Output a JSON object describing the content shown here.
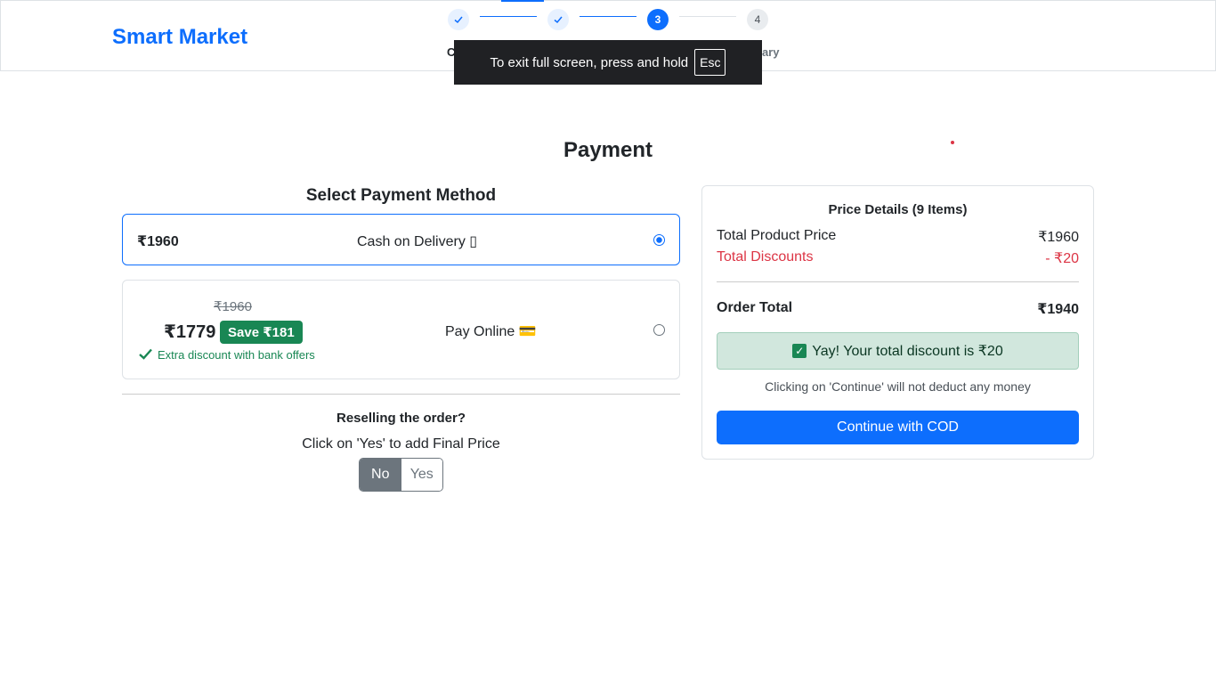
{
  "brand": "Smart Market",
  "steps": [
    {
      "label": "C",
      "state": "done"
    },
    {
      "label": "",
      "state": "done"
    },
    {
      "number": "3",
      "state": "active"
    },
    {
      "number": "4",
      "label": "nary",
      "state": "todo"
    }
  ],
  "fullscreen_toast": {
    "text": "To exit full screen, press and hold",
    "key": "Esc"
  },
  "page_title": "Payment",
  "payment_section": {
    "title": "Select Payment Method",
    "cod": {
      "price": "₹1960",
      "label": "Cash on Delivery ▯",
      "selected": true
    },
    "online": {
      "original_price": "₹1960",
      "price": "₹1779",
      "save_badge": "Save ₹181",
      "offer": "Extra discount with bank offers",
      "label": "Pay Online 💳",
      "selected": false
    }
  },
  "reselling": {
    "question": "Reselling the order?",
    "instruction": "Click on 'Yes' to add Final Price",
    "options": [
      "No",
      "Yes"
    ],
    "selected": "No"
  },
  "price_details": {
    "title": "Price Details (9 Items)",
    "total_product_label": "Total Product Price",
    "total_product_value": "₹1960",
    "discount_label": "Total Discounts",
    "discount_value": "- ₹20",
    "order_total_label": "Order Total",
    "order_total_value": "₹1940",
    "discount_alert": "Yay! Your total discount is ₹20",
    "note": "Clicking on 'Continue' will not deduct any money",
    "continue_button": "Continue with COD"
  },
  "colors": {
    "primary": "#0d6efd",
    "success": "#198754",
    "danger": "#dc3545",
    "secondary": "#6c757d"
  }
}
